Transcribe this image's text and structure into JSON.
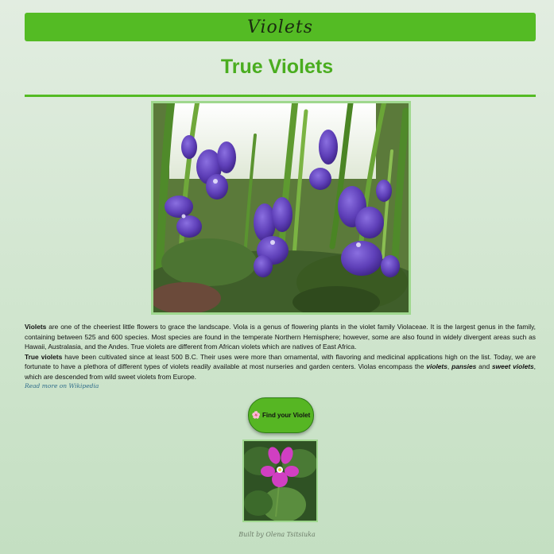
{
  "header": {
    "banner_title": "Violets",
    "page_title": "True Violets"
  },
  "main_image": {
    "alt": "Purple violets growing among grass"
  },
  "description": {
    "p1_bold": "Violets",
    "p1_text": " are one of the cheeriest little flowers to grace the landscape. Viola is a genus of flowering plants in the violet family Violaceae. It is the largest genus in the family, containing between 525 and 600 species. Most species are found in the temperate Northern Hemisphere; however, some are also found in widely divergent areas such as Hawaii, Australasia, and the Andes. True violets are different from African violets which are natives of East Africa.",
    "p2_bold": "True violets",
    "p2_text": " have been cultivated since at least 500 B.C. Their uses were more than ornamental, with flavoring and medicinal applications high on the list. Today, we are fortunate to have a plethora of different types of violets readily available at most nurseries and garden centers. Violas encompass the ",
    "p2_em1": "violets",
    "p2_sep": ", ",
    "p2_em2": "pansies",
    "p2_and": " and ",
    "p2_em3": "sweet violets",
    "p2_tail": ", which are descended from wild sweet violets from Europe."
  },
  "read_more": "Read more on Wikipedia",
  "find_button": {
    "icon": "flower-icon",
    "label": "Find your Violet"
  },
  "thumb_image": {
    "alt": "Single magenta violet flower"
  },
  "footer": {
    "credit": "Built by Olena Tsitsiuka"
  },
  "colors": {
    "accent": "#54bb24",
    "title": "#4aad1f",
    "border": "#9fd88e"
  }
}
